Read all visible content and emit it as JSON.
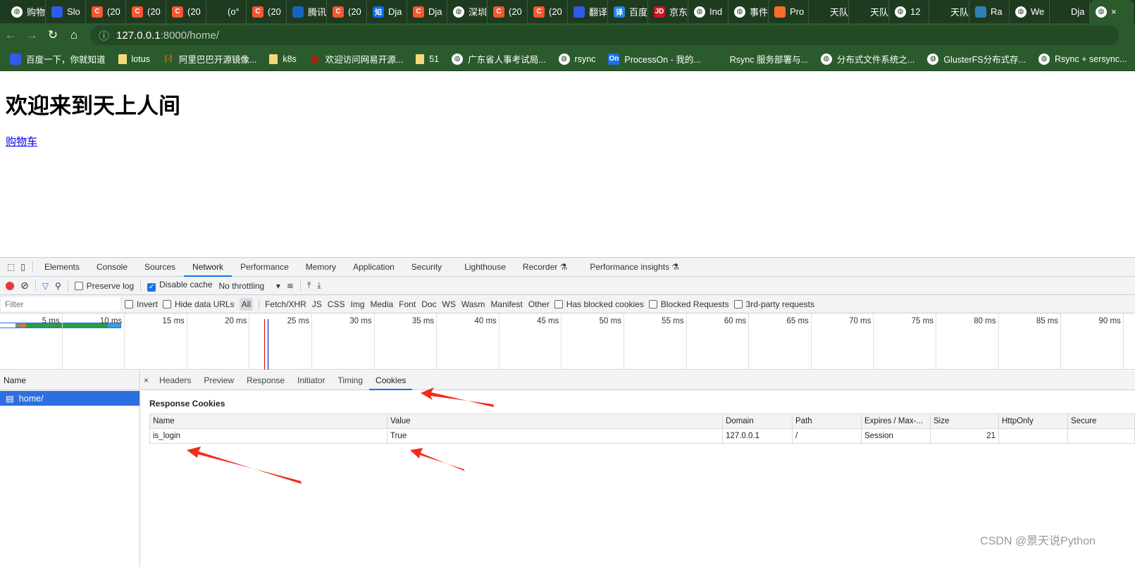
{
  "browser": {
    "tabs": [
      {
        "icon": "globe",
        "label": "购物"
      },
      {
        "icon": "baidu",
        "label": "Slo"
      },
      {
        "icon": "csdn",
        "label": "(20"
      },
      {
        "icon": "csdn",
        "label": "(20"
      },
      {
        "icon": "csdn",
        "label": "(20"
      },
      {
        "icon": "misc",
        "label": "(o°"
      },
      {
        "icon": "csdn",
        "label": "(20"
      },
      {
        "icon": "m",
        "label": "腾讯"
      },
      {
        "icon": "csdn",
        "label": "(20"
      },
      {
        "icon": "zhihu",
        "label": "Dja"
      },
      {
        "icon": "csdn",
        "label": "Dja"
      },
      {
        "icon": "globe",
        "label": "深圳"
      },
      {
        "icon": "csdn",
        "label": "(20"
      },
      {
        "icon": "csdn",
        "label": "(20"
      },
      {
        "icon": "baidu",
        "label": "翻译"
      },
      {
        "icon": "fanyi",
        "label": "百度"
      },
      {
        "icon": "jd",
        "label": "京东"
      },
      {
        "icon": "globe",
        "label": "Ind"
      },
      {
        "icon": "globe",
        "label": "事件"
      },
      {
        "icon": "gitlab",
        "label": "Pro"
      },
      {
        "icon": "misc2",
        "label": "天队"
      },
      {
        "icon": "misc2",
        "label": "天队"
      },
      {
        "icon": "globe",
        "label": "12"
      },
      {
        "icon": "misc2",
        "label": "天队"
      },
      {
        "icon": "rancher",
        "label": "Ra"
      },
      {
        "icon": "globe",
        "label": "We"
      },
      {
        "icon": "misc",
        "label": "Dja"
      }
    ],
    "active_tab": {
      "close": "×"
    },
    "url_host": "127.0.0.1",
    "url_path": ":8000/home/",
    "bookmarks": [
      {
        "icon": "baidu",
        "label": "百度一下，你就知道"
      },
      {
        "icon": "folder",
        "label": "lotus"
      },
      {
        "icon": "aliyun",
        "label": "阿里巴巴开源镜像..."
      },
      {
        "icon": "folder",
        "label": "k8s"
      },
      {
        "icon": "netease",
        "label": "欢迎访问网易开源..."
      },
      {
        "icon": "folder",
        "label": "51"
      },
      {
        "icon": "globe",
        "label": "广东省人事考试局..."
      },
      {
        "icon": "globe",
        "label": "rsync"
      },
      {
        "icon": "processon",
        "label": "ProcessOn - 我的..."
      },
      {
        "icon": "misc",
        "label": "Rsync 服务部署与..."
      },
      {
        "icon": "globe",
        "label": "分布式文件系统之..."
      },
      {
        "icon": "globe",
        "label": "GlusterFS分布式存..."
      },
      {
        "icon": "globe",
        "label": "Rsync + sersync..."
      }
    ]
  },
  "page": {
    "heading": "欢迎来到天上人间",
    "link": "购物车"
  },
  "devtools": {
    "tabs": [
      "Elements",
      "Console",
      "Sources",
      "Network",
      "Performance",
      "Memory",
      "Application",
      "Security",
      "Lighthouse",
      "Recorder ⚗",
      "Performance insights ⚗"
    ],
    "active_tab": "Network",
    "toolbar": {
      "preserve_log": "Preserve log",
      "disable_cache": "Disable cache",
      "disable_cache_checked": true,
      "throttling": "No throttling"
    },
    "filter": {
      "placeholder": "Filter",
      "invert": "Invert",
      "hide_data_urls": "Hide data URLs",
      "types": [
        "All",
        "Fetch/XHR",
        "JS",
        "CSS",
        "Img",
        "Media",
        "Font",
        "Doc",
        "WS",
        "Wasm",
        "Manifest",
        "Other"
      ],
      "active_type": "All",
      "has_blocked_cookies": "Has blocked cookies",
      "blocked_requests": "Blocked Requests",
      "third_party": "3rd-party requests"
    },
    "timeline_ticks": [
      "5 ms",
      "10 ms",
      "15 ms",
      "20 ms",
      "25 ms",
      "30 ms",
      "35 ms",
      "40 ms",
      "45 ms",
      "50 ms",
      "55 ms",
      "60 ms",
      "65 ms",
      "70 ms",
      "75 ms",
      "80 ms",
      "85 ms",
      "90 ms"
    ],
    "request_list": {
      "header": "Name",
      "items": [
        "home/"
      ]
    },
    "detail_tabs": [
      "Headers",
      "Preview",
      "Response",
      "Initiator",
      "Timing",
      "Cookies"
    ],
    "detail_active": "Cookies",
    "response_cookies": {
      "title": "Response Cookies",
      "columns": [
        "Name",
        "Value",
        "Domain",
        "Path",
        "Expires / Max-...",
        "Size",
        "HttpOnly",
        "Secure"
      ],
      "rows": [
        [
          "is_login",
          "True",
          "127.0.0.1",
          "/",
          "Session",
          "21",
          "",
          ""
        ]
      ]
    }
  },
  "annotation_color": "#f5291c",
  "watermark": "CSDN @景天说Python"
}
